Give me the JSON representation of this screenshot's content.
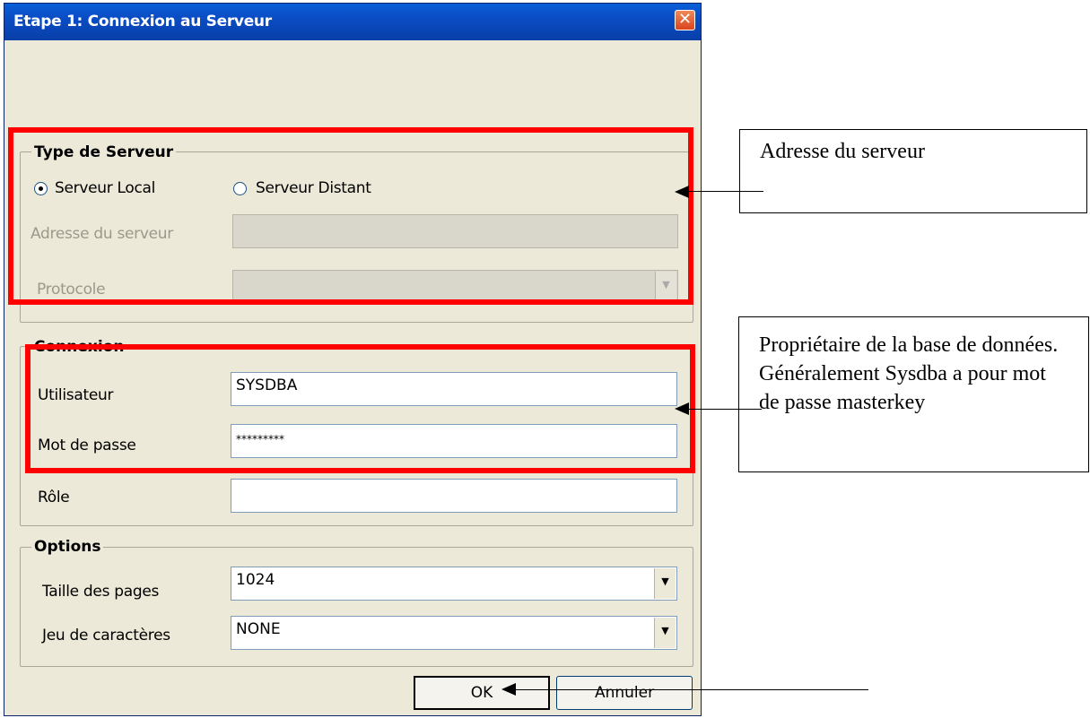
{
  "window": {
    "title": "Etape 1: Connexion au Serveur",
    "close_icon": "close-icon",
    "close_glyph": "✕"
  },
  "server_type": {
    "legend": "Type de Serveur",
    "radio_local": "Serveur Local",
    "radio_remote": "Serveur Distant",
    "selected": "Serveur Local",
    "address_label": "Adresse du serveur",
    "address_value": "",
    "protocol_label": "Protocole",
    "protocol_value": ""
  },
  "connection": {
    "legend": "Connexion",
    "user_label": "Utilisateur",
    "user_value": "SYSDBA",
    "password_label": "Mot de passe",
    "password_value": "*********",
    "role_label": "Rôle",
    "role_value": ""
  },
  "options": {
    "legend": "Options",
    "page_size_label": "Taille des pages",
    "page_size_value": "1024",
    "charset_label": "Jeu de caractères",
    "charset_value": "NONE"
  },
  "buttons": {
    "ok": "OK",
    "cancel": "Annuler"
  },
  "annotations": {
    "callout_address": "Adresse du serveur",
    "callout_owner": "Propriétaire de la base de données. Généralement Sysdba a pour mot de passe masterkey",
    "highlight_color": "#ff0000"
  }
}
